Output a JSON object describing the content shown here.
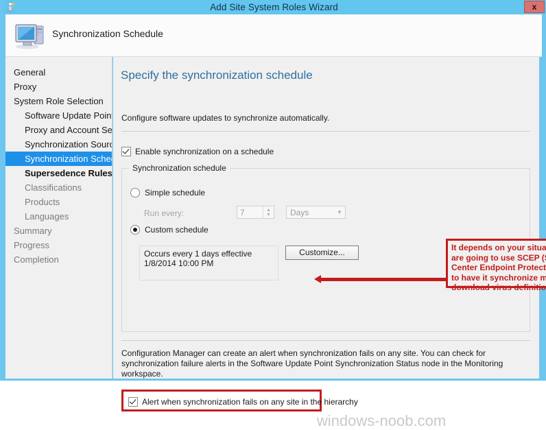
{
  "window": {
    "title": "Add Site System Roles Wizard",
    "close_label": "x",
    "titlebar_icon": "wizard-icon",
    "accent_color": "#62c6ee"
  },
  "header": {
    "title": "Synchronization Schedule",
    "icon": "computer-icon"
  },
  "sidebar": {
    "items": [
      {
        "label": "General",
        "level": 0,
        "state": "done"
      },
      {
        "label": "Proxy",
        "level": 0,
        "state": "done"
      },
      {
        "label": "System Role Selection",
        "level": 0,
        "state": "done"
      },
      {
        "label": "Software Update Point",
        "level": 1,
        "state": "done"
      },
      {
        "label": "Proxy and Account Settin",
        "level": 1,
        "state": "done"
      },
      {
        "label": "Synchronization Source",
        "level": 1,
        "state": "done"
      },
      {
        "label": "Synchronization Schedule",
        "level": 1,
        "state": "selected"
      },
      {
        "label": "Supersedence Rules",
        "level": 1,
        "state": "strong"
      },
      {
        "label": "Classifications",
        "level": 1,
        "state": "dim"
      },
      {
        "label": "Products",
        "level": 1,
        "state": "dim"
      },
      {
        "label": "Languages",
        "level": 1,
        "state": "dim"
      },
      {
        "label": "Summary",
        "level": 0,
        "state": "dim"
      },
      {
        "label": "Progress",
        "level": 0,
        "state": "dim"
      },
      {
        "label": "Completion",
        "level": 0,
        "state": "dim"
      }
    ],
    "selected_color": "#1e90e8"
  },
  "content": {
    "heading": "Specify the synchronization schedule",
    "intro": "Configure software updates to synchronize automatically.",
    "enable_sync": {
      "label": "Enable synchronization on a schedule",
      "checked": true
    },
    "group": {
      "legend": "Synchronization schedule",
      "simple_schedule": {
        "label": "Simple schedule",
        "selected": false
      },
      "run_every_label": "Run every:",
      "interval_value": "7",
      "unit_value": "Days",
      "custom_schedule": {
        "label": "Custom schedule",
        "selected": true
      },
      "occurs_text": "Occurs every 1 days effective 1/8/2014 10:00 PM",
      "customize_button": "Customize..."
    },
    "footer_note": "Configuration Manager can create an alert when synchronization fails on any site. You can check for synchronization failure alerts in the Software Update Point Synchronization Status node in the Monitoring workspace.",
    "alert_checkbox": {
      "label": "Alert when synchronization fails on any site in the hierarchy",
      "checked": true
    }
  },
  "annotation": {
    "text": "It depends on your situation, if you are going to use SCEP (System Center Endpoint Protection) is better to have it synchronize more to download virus definitions",
    "color": "#c21d1d"
  },
  "watermark": "windows-noob.com"
}
